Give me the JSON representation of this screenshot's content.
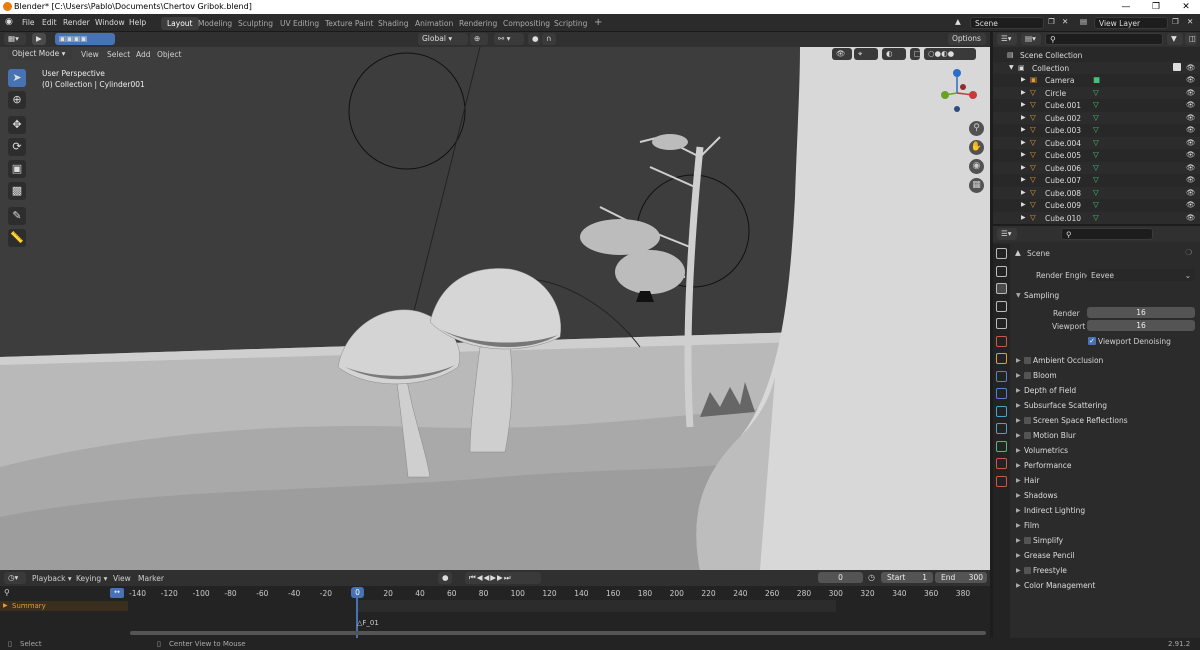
{
  "window": {
    "title": "Blender* [C:\\Users\\Pablo\\Documents\\Chertov Gribok.blend]"
  },
  "menu": [
    "File",
    "Edit",
    "Render",
    "Window",
    "Help"
  ],
  "workspaces": [
    "Layout",
    "Modeling",
    "Sculpting",
    "UV Editing",
    "Texture Paint",
    "Shading",
    "Animation",
    "Rendering",
    "Compositing",
    "Scripting"
  ],
  "active_workspace": "Layout",
  "scene_field": "Scene",
  "view_layer_field": "View Layer",
  "viewport_header": {
    "transform_orientation": "Global",
    "mode": "Object Mode",
    "menus": [
      "View",
      "Select",
      "Add",
      "Object"
    ],
    "options": "Options"
  },
  "viewport": {
    "perspective": "User Perspective",
    "context": "(0) Collection | Cylinder001",
    "background": "#3f3f3f"
  },
  "outliner": {
    "root": "Scene Collection",
    "collection": "Collection",
    "items": [
      "Camera",
      "Circle",
      "Cube.001",
      "Cube.002",
      "Cube.003",
      "Cube.004",
      "Cube.005",
      "Cube.006",
      "Cube.007",
      "Cube.008",
      "Cube.009",
      "Cube.010"
    ]
  },
  "properties": {
    "context": "Scene",
    "render_engine_label": "Render Engine",
    "render_engine": "Eevee",
    "sampling_label": "Sampling",
    "render_label": "Render",
    "render_samples": "16",
    "viewport_label": "Viewport",
    "viewport_samples": "16",
    "viewport_denoising": "Viewport Denoising",
    "panels": [
      {
        "label": "Ambient Occlusion",
        "checkbox": true
      },
      {
        "label": "Bloom",
        "checkbox": true
      },
      {
        "label": "Depth of Field",
        "checkbox": false
      },
      {
        "label": "Subsurface Scattering",
        "checkbox": false
      },
      {
        "label": "Screen Space Reflections",
        "checkbox": true
      },
      {
        "label": "Motion Blur",
        "checkbox": true
      },
      {
        "label": "Volumetrics",
        "checkbox": false
      },
      {
        "label": "Performance",
        "checkbox": false
      },
      {
        "label": "Hair",
        "checkbox": false
      },
      {
        "label": "Shadows",
        "checkbox": false
      },
      {
        "label": "Indirect Lighting",
        "checkbox": false
      },
      {
        "label": "Film",
        "checkbox": false
      },
      {
        "label": "Simplify",
        "checkbox": true
      },
      {
        "label": "Grease Pencil",
        "checkbox": false
      },
      {
        "label": "Freestyle",
        "checkbox": true
      },
      {
        "label": "Color Management",
        "checkbox": false
      }
    ]
  },
  "timeline": {
    "menus": [
      "Playback",
      "Keying",
      "View",
      "Marker"
    ],
    "current_frame": "0",
    "start_label": "Start",
    "start": "1",
    "end_label": "End",
    "end": "300",
    "ticks": [
      "-140",
      "-120",
      "-100",
      "-80",
      "-60",
      "-40",
      "-20",
      "0",
      "20",
      "40",
      "60",
      "80",
      "100",
      "120",
      "140",
      "160",
      "180",
      "200",
      "220",
      "240",
      "260",
      "280",
      "300",
      "320",
      "340",
      "360",
      "380"
    ],
    "summary": "Summary",
    "marker": "F_01"
  },
  "statusbar": {
    "left": "Select",
    "middle": "Center View to Mouse",
    "version": "2.91.2"
  }
}
